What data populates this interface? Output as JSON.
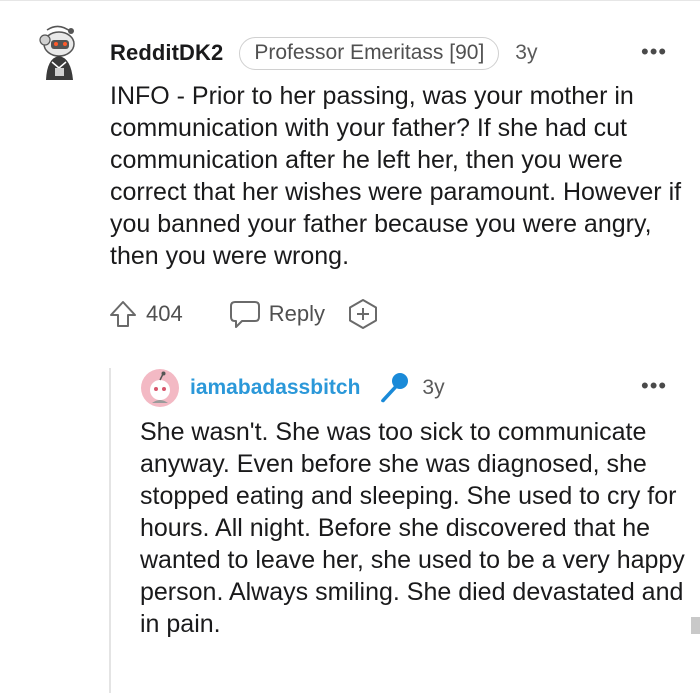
{
  "parent_comment": {
    "username": "RedditDK2",
    "flair": "Professor Emeritass [90]",
    "time": "3y",
    "more_label": "•••",
    "body": "INFO - Prior to her passing, was your mother in communication with your father? If she had cut communication after he left her, then you were correct that her wishes were paramount. However if you banned your father because you were angry, then you were wrong.",
    "vote_count": "404",
    "reply_label": "Reply",
    "avatar_icon": "snoo-avatar-icon"
  },
  "reply_comment": {
    "username": "iamabadassbitch",
    "badge_icon": "microphone-icon",
    "time": "3y",
    "more_label": "•••",
    "body": "She wasn't. She was too sick to communicate anyway. Even before she was diagnosed, she stopped eating and sleeping. She used to cry for hours. All night. Before she discovered that he wanted to leave her, she used to be a very happy person. Always smiling. She died devastated and in pain.",
    "avatar_icon": "snoo-avatar-icon"
  },
  "colors": {
    "reply_username": "#2b98d9",
    "avatar_pink": "#f3b9c4",
    "mic_blue": "#1a8ad8",
    "text": "#1a1a1b",
    "muted": "#5a5a5a"
  }
}
